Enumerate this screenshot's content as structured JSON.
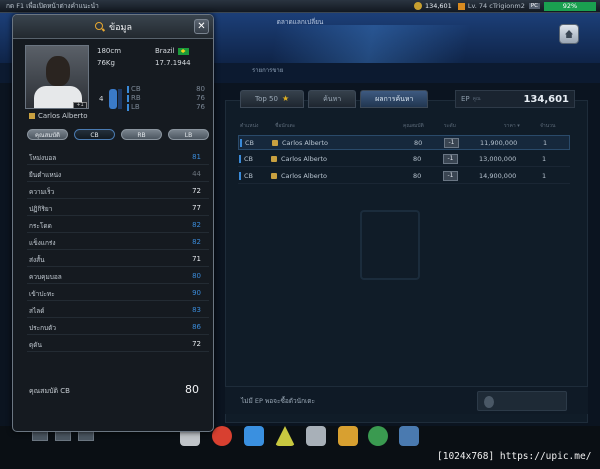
{
  "topbar": {
    "hint": "กด F1 เพื่อเปิดหน้าต่างคำแนะนำ",
    "ep_value": "134,601",
    "level_text": "Lv. 74 cTrigionm2",
    "pc_badge": "PC",
    "battery": "92%"
  },
  "header": {
    "exchange_tab": "ตลาดแลกเปลี่ยน",
    "sell_list_tab": "รายการขาย"
  },
  "market": {
    "tabs": [
      {
        "label": "Top 50"
      },
      {
        "label": "ค้นหา"
      },
      {
        "label": "ผลการค้นหา"
      }
    ],
    "ep_label": "EP",
    "ep_sub": "คูณ",
    "ep_value": "134,601",
    "columns": {
      "position": "ตำแหน่ง",
      "name": "ชื่อนักเตะ",
      "ovr": "คุณสมบัติ",
      "enhance": "ระดับ",
      "price": "ราคา ▾",
      "qty": "จำนวน"
    },
    "rows": [
      {
        "pos": "CB",
        "name": "Carlos Alberto",
        "ovr": "80",
        "btn": "-1",
        "price": "11,900,000",
        "qty": "1"
      },
      {
        "pos": "CB",
        "name": "Carlos Alberto",
        "ovr": "80",
        "btn": "-1",
        "price": "13,000,000",
        "qty": "1"
      },
      {
        "pos": "CB",
        "name": "Carlos Alberto",
        "ovr": "80",
        "btn": "-1",
        "price": "14,900,000",
        "qty": "1"
      }
    ],
    "footer_msg": "ไม่มี EP พอจะซื้อตัวนักเตะ"
  },
  "popup": {
    "title": "ข้อมูล",
    "close": "✕",
    "height": "180cm",
    "weight": "76Kg",
    "nation": "Brazil",
    "birth": "17.7.1944",
    "mini_number": "4",
    "positions": [
      {
        "code": "CB",
        "value": "80"
      },
      {
        "code": "RB",
        "value": "76"
      },
      {
        "code": "LB",
        "value": "76"
      }
    ],
    "player_name": "Carlos Alberto",
    "photo_badge": "+1",
    "position_tabs": [
      "คุณสมบัติ",
      "CB",
      "RB",
      "LB"
    ],
    "stats": [
      {
        "name": "โหม่งบอล",
        "value": "81",
        "color": "#3a8ad8"
      },
      {
        "name": "ยืนตำแหน่ง",
        "value": "44",
        "color": "#6a737c"
      },
      {
        "name": "ความเร็ว",
        "value": "72",
        "color": "#e6eaee"
      },
      {
        "name": "ปฏิกิริยา",
        "value": "77",
        "color": "#e6eaee"
      },
      {
        "name": "กระโดด",
        "value": "82",
        "color": "#3a8ad8"
      },
      {
        "name": "แข็งแกร่ง",
        "value": "82",
        "color": "#3a8ad8"
      },
      {
        "name": "ส่งสั้น",
        "value": "71",
        "color": "#e6eaee"
      },
      {
        "name": "ควบคุมบอล",
        "value": "80",
        "color": "#3a8ad8"
      },
      {
        "name": "เข้าปะทะ",
        "value": "90",
        "color": "#3a8ad8"
      },
      {
        "name": "สไลด์",
        "value": "83",
        "color": "#3a8ad8"
      },
      {
        "name": "ประกบตัว",
        "value": "86",
        "color": "#3a8ad8"
      },
      {
        "name": "ดุดัน",
        "value": "72",
        "color": "#e6eaee"
      }
    ],
    "summary_label": "คุณสมบัติ CB",
    "summary_value": "80"
  },
  "credit": "[1024x768] https://upic.me/"
}
